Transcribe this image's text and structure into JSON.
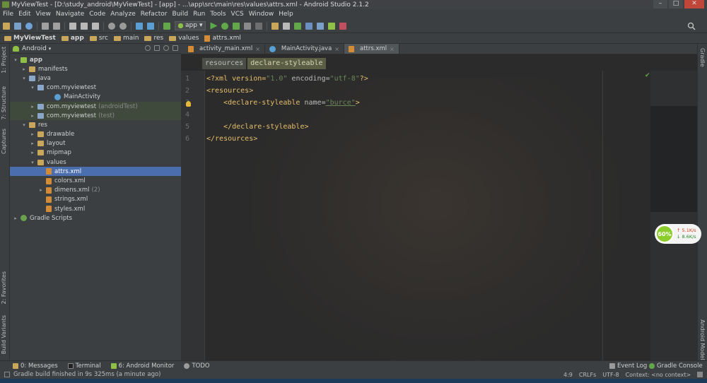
{
  "window": {
    "title": "MyViewTest - [D:\\study_android\\MyViewTest] - [app] - ...\\app\\src\\main\\res\\values\\attrs.xml - Android Studio 2.1.2",
    "buttons": {
      "minimize": "–",
      "maximize": "□",
      "close": "✕"
    }
  },
  "menu": [
    "File",
    "Edit",
    "View",
    "Navigate",
    "Code",
    "Analyze",
    "Refactor",
    "Build",
    "Run",
    "Tools",
    "VCS",
    "Window",
    "Help"
  ],
  "toolbar": {
    "run_config": "app",
    "run_config_arrow": "▾"
  },
  "breadcrumb": [
    "MyViewTest",
    "app",
    "src",
    "main",
    "res",
    "values",
    "attrs.xml"
  ],
  "left_strip": {
    "project": "1: Project",
    "structure": "7: Structure",
    "captures": "Captures",
    "favorites": "2: Favorites",
    "build_variants": "Build Variants"
  },
  "right_strip": {
    "gradle": "Gradle",
    "android_model": "Android Model"
  },
  "project_panel": {
    "view_mode": "Android",
    "tree": [
      {
        "arrow": "▾",
        "icon": "app",
        "label": "app",
        "suffix": ""
      },
      {
        "arrow": "▸",
        "icon": "folder",
        "label": "manifests",
        "suffix": ""
      },
      {
        "arrow": "▾",
        "icon": "bluef",
        "label": "java",
        "suffix": ""
      },
      {
        "arrow": "▾",
        "icon": "bluef",
        "label": "com.myviewtest",
        "suffix": ""
      },
      {
        "arrow": "",
        "icon": "javac",
        "label": "MainActivity",
        "suffix": ""
      },
      {
        "arrow": "▸",
        "icon": "bluef",
        "label": "com.myviewtest",
        "suffix": "(androidTest)"
      },
      {
        "arrow": "▸",
        "icon": "bluef",
        "label": "com.myviewtest",
        "suffix": "(test)"
      },
      {
        "arrow": "▾",
        "icon": "res",
        "label": "res",
        "suffix": ""
      },
      {
        "arrow": "▸",
        "icon": "folder",
        "label": "drawable",
        "suffix": ""
      },
      {
        "arrow": "▸",
        "icon": "folder",
        "label": "layout",
        "suffix": ""
      },
      {
        "arrow": "▸",
        "icon": "folder",
        "label": "mipmap",
        "suffix": ""
      },
      {
        "arrow": "▾",
        "icon": "folder",
        "label": "values",
        "suffix": ""
      },
      {
        "arrow": "",
        "icon": "xml",
        "label": "attrs.xml",
        "suffix": ""
      },
      {
        "arrow": "",
        "icon": "xml",
        "label": "colors.xml",
        "suffix": ""
      },
      {
        "arrow": "▸",
        "icon": "xml",
        "label": "dimens.xml",
        "suffix": "(2)"
      },
      {
        "arrow": "",
        "icon": "xml",
        "label": "strings.xml",
        "suffix": ""
      },
      {
        "arrow": "",
        "icon": "xml",
        "label": "styles.xml",
        "suffix": ""
      },
      {
        "arrow": "▸",
        "icon": "gradle",
        "label": "Gradle Scripts",
        "suffix": ""
      }
    ]
  },
  "editor_tabs": [
    {
      "label": "activity_main.xml",
      "close": "×"
    },
    {
      "label": "MainActivity.java",
      "close": "×"
    },
    {
      "label": "attrs.xml",
      "close": "×"
    }
  ],
  "xml_path": [
    "resources",
    "declare-styleable"
  ],
  "code": {
    "line_numbers": [
      "1",
      "2",
      "3",
      "4",
      "5",
      "6"
    ],
    "l1": {
      "a": "<?xml version=",
      "b": "\"1.0\"",
      "c": " encoding=",
      "d": "\"utf-8\"",
      "e": "?>"
    },
    "l2": "<resources>",
    "l3": {
      "a": "    <declare-styleable ",
      "b": "name=",
      "c": "\"burce\"",
      "d": ">"
    },
    "l5": "    </declare-styleable>",
    "l6": "</resources>"
  },
  "net_widget": {
    "percent": "60%",
    "up": "↑ 5.1K/s",
    "down": "↓ 8.6K/s"
  },
  "bottom_tools": {
    "messages": "0: Messages",
    "terminal": "Terminal",
    "android_monitor": "6: Android Monitor",
    "todo": "TODO",
    "event_log": "Event Log",
    "gradle_console": "Gradle Console"
  },
  "status": {
    "message": "Gradle build finished in 9s 325ms (a minute ago)",
    "position": "4:9",
    "line_sep": "CRLFs",
    "encoding": "UTF-8",
    "context": "Context: <no context>"
  },
  "colors": {
    "selection": "#4b6eaf",
    "tag": "#e8bf6a",
    "string": "#6a8759",
    "background": "#2b2b2b"
  }
}
